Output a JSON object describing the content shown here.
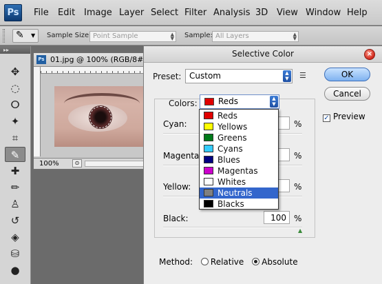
{
  "app": {
    "logo": "Ps"
  },
  "menu": [
    "File",
    "Edit",
    "Image",
    "Layer",
    "Select",
    "Filter",
    "Analysis",
    "3D",
    "View",
    "Window",
    "Help"
  ],
  "options": {
    "sample_size_label": "Sample Size:",
    "sample_size_value": "Point Sample",
    "sample_label": "Sample:",
    "sample_value": "All Layers"
  },
  "document": {
    "title": "01.jpg @ 100% (RGB/8#",
    "zoom": "100%"
  },
  "dialog": {
    "title": "Selective Color",
    "close": "×",
    "preset_label": "Preset:",
    "preset_value": "Custom",
    "preset_menu_icon": "list-menu-icon",
    "ok": "OK",
    "cancel": "Cancel",
    "preview_label": "Preview",
    "preview_checked": true,
    "colors_label": "Colors:",
    "colors_value": "Reds",
    "sliders": [
      {
        "label": "Cyan:",
        "value": "",
        "unit": "%"
      },
      {
        "label": "Magenta:",
        "value": "",
        "unit": "%"
      },
      {
        "label": "Yellow:",
        "value": "",
        "unit": "%"
      },
      {
        "label": "Black:",
        "value": "100",
        "unit": "%"
      }
    ],
    "method_label": "Method:",
    "method_relative": "Relative",
    "method_absolute": "Absolute",
    "method_selected": "Absolute"
  },
  "color_options": [
    {
      "label": "Reds",
      "color": "#e00000"
    },
    {
      "label": "Yellows",
      "color": "#ffff00"
    },
    {
      "label": "Greens",
      "color": "#007a1a"
    },
    {
      "label": "Cyans",
      "color": "#33ccff"
    },
    {
      "label": "Blues",
      "color": "#000080"
    },
    {
      "label": "Magentas",
      "color": "#cc00cc"
    },
    {
      "label": "Whites",
      "color": "#ffffff"
    },
    {
      "label": "Neutrals",
      "color": "#808080",
      "selected": true
    },
    {
      "label": "Blacks",
      "color": "#000000"
    }
  ],
  "tools": [
    "move-icon",
    "marquee-icon",
    "lasso-icon",
    "magic-wand-icon",
    "crop-icon",
    "eyedropper-icon",
    "healing-icon",
    "brush-icon",
    "clone-stamp-icon",
    "history-brush-icon",
    "eraser-icon",
    "paint-bucket-icon",
    "dodge-icon",
    "pen-icon"
  ]
}
